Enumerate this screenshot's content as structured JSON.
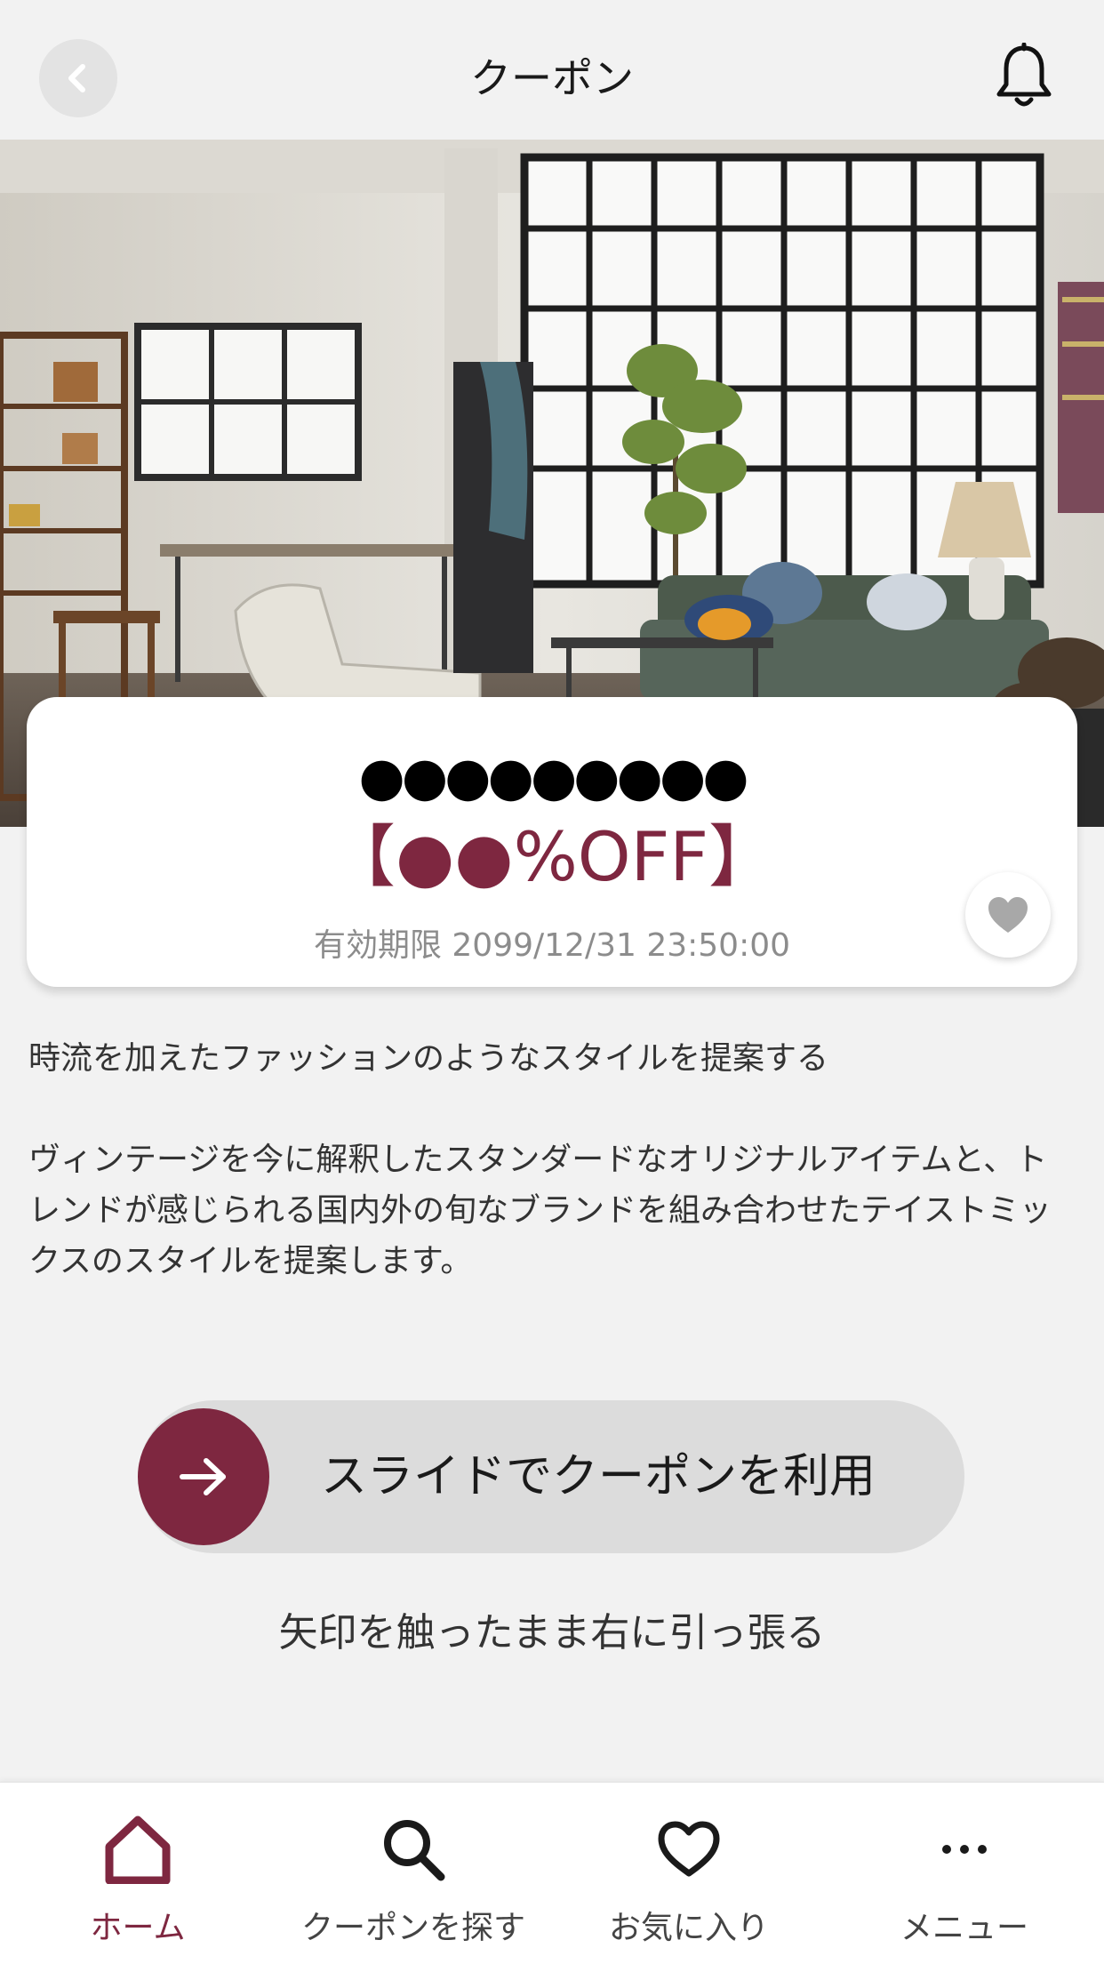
{
  "header": {
    "title": "クーポン",
    "back_icon": "chevron-left-icon",
    "bell_icon": "bell-icon"
  },
  "hero": {
    "icon": "photo-interior-icon"
  },
  "coupon": {
    "name": "●●●●●●●●●",
    "discount": "【●●%OFF】",
    "expiry": "有効期限 2099/12/31 23:50:00",
    "favorite_icon": "heart-icon"
  },
  "description": {
    "lead": "時流を加えたファッションのようなスタイルを提案する",
    "body": "ヴィンテージを今に解釈したスタンダードなオリジナルアイテムと、トレンドが感じられる国内外の旬なブランドを組み合わせたテイストミックスのスタイルを提案します。"
  },
  "slider": {
    "label": "スライドでクーポンを利用",
    "hint": "矢印を触ったまま右に引っ張る",
    "icon": "arrow-right-icon"
  },
  "tabbar": {
    "tabs": [
      {
        "label": "ホーム",
        "icon": "home-icon",
        "active": true
      },
      {
        "label": "クーポンを探す",
        "icon": "search-icon",
        "active": false
      },
      {
        "label": "お気に入り",
        "icon": "heart-outline-icon",
        "active": false
      },
      {
        "label": "メニュー",
        "icon": "more-icon",
        "active": false
      }
    ]
  },
  "colors": {
    "accent": "#7e2740",
    "background": "#f2f2f2",
    "card": "#ffffff",
    "slider_track": "#dcdcdc"
  }
}
